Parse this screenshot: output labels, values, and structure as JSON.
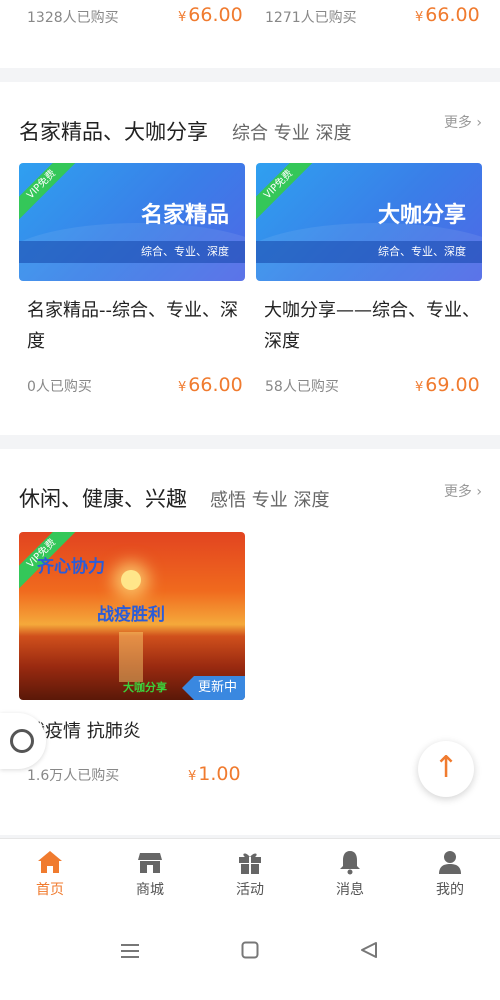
{
  "top_row": {
    "left": {
      "buyers": "1328人已购买",
      "price": "66.00"
    },
    "right": {
      "buyers": "1271人已购买",
      "price": "66.00"
    }
  },
  "section1": {
    "title": "名家精品、大咖分享",
    "subtitle": "综合 专业 深度",
    "more": "更多",
    "items": [
      {
        "vip": "VIP免费",
        "banner_big": "名家精品",
        "banner_small": "综合、专业、深度",
        "title": "名家精品--综合、专业、深度",
        "buyers": "0人已购买",
        "price": "66.00"
      },
      {
        "vip": "VIP免费",
        "banner_big": "大咖分享",
        "banner_small": "综合、专业、深度",
        "title": "大咖分享——综合、专业、深度",
        "buyers": "58人已购买",
        "price": "69.00"
      }
    ]
  },
  "section2": {
    "title": "休闲、健康、兴趣",
    "subtitle": "感悟 专业 深度",
    "more": "更多",
    "item": {
      "vip": "VIP免费",
      "line1": "齐心协力",
      "line2": "战疫胜利",
      "green_tag": "大咖分享",
      "tag": "更新中",
      "title": "战疫情 抗肺炎",
      "buyers": "1.6万人已购买",
      "price": "1.00"
    }
  },
  "currency": "¥",
  "totop_glyph": "↑",
  "tabs": [
    {
      "label": "首页",
      "icon": "home-icon",
      "active": true
    },
    {
      "label": "商城",
      "icon": "store-icon",
      "active": false
    },
    {
      "label": "活动",
      "icon": "gift-icon",
      "active": false
    },
    {
      "label": "消息",
      "icon": "bell-icon",
      "active": false
    },
    {
      "label": "我的",
      "icon": "user-icon",
      "active": false
    }
  ],
  "colors": {
    "accent": "#f07b2f",
    "vip": "#34c759",
    "banner_blue": "#3a7ee8"
  }
}
